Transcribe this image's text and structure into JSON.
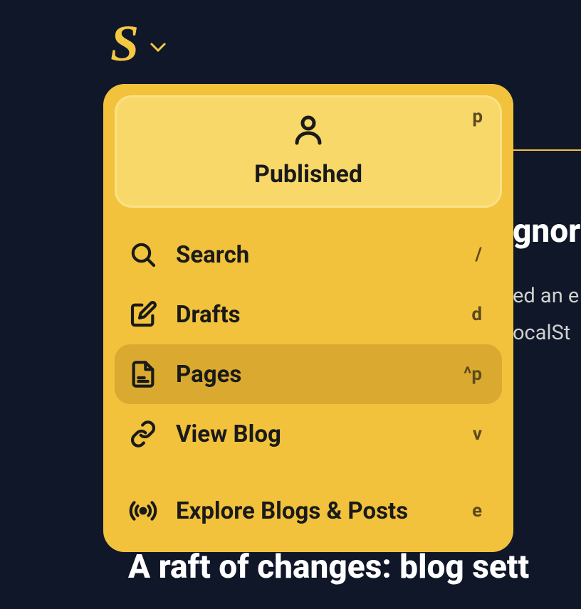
{
  "logo": {
    "letter": "S"
  },
  "activeItem": {
    "label": "Published",
    "shortcut": "p"
  },
  "menuItems": [
    {
      "label": "Search",
      "shortcut": "/",
      "icon": "search"
    },
    {
      "label": "Drafts",
      "shortcut": "d",
      "icon": "edit"
    },
    {
      "label": "Pages",
      "shortcut": "^p",
      "icon": "page",
      "hovered": true
    },
    {
      "label": "View Blog",
      "shortcut": "v",
      "icon": "link"
    },
    {
      "label": "Explore Blogs & Posts",
      "shortcut": "e",
      "icon": "broadcast",
      "dividerBefore": true
    }
  ],
  "background": {
    "title1": "gnor",
    "text1": "ed an e",
    "text2": "ocalSt",
    "title2": "A raft of changes: blog sett"
  }
}
